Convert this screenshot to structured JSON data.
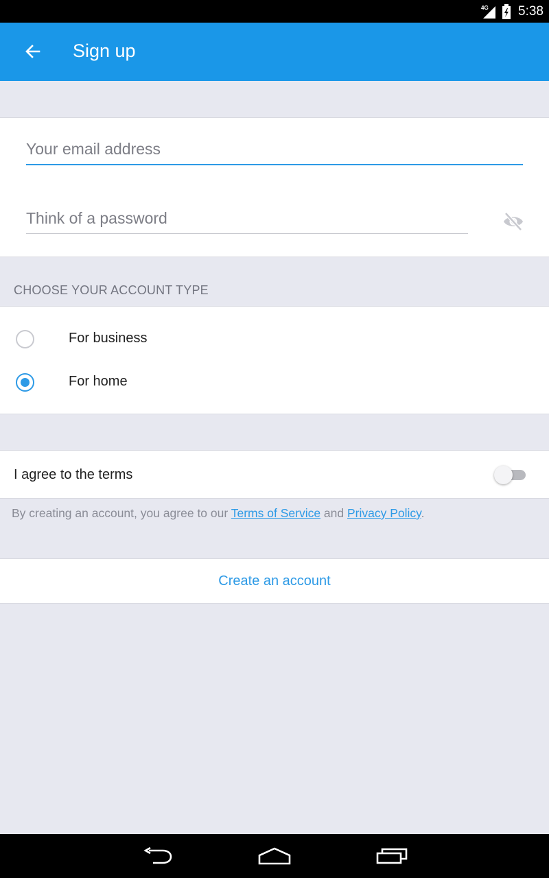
{
  "status_bar": {
    "network": "4G",
    "time": "5:38"
  },
  "app_bar": {
    "title": "Sign up",
    "color": "#1a97e8"
  },
  "form": {
    "email": {
      "placeholder": "Your email address",
      "value": ""
    },
    "password": {
      "placeholder": "Think of a password",
      "value": ""
    }
  },
  "account_type": {
    "header": "CHOOSE YOUR ACCOUNT TYPE",
    "options": [
      {
        "label": "For business",
        "selected": false
      },
      {
        "label": "For home",
        "selected": true
      }
    ]
  },
  "terms": {
    "label": "I agree to the terms",
    "toggle_on": false,
    "legal_prefix": "By creating an account, you agree to our ",
    "tos_link": "Terms of Service",
    "legal_and": " and ",
    "privacy_link": "Privacy Policy",
    "legal_suffix": "."
  },
  "actions": {
    "create_account": "Create an account"
  },
  "colors": {
    "accent": "#2d9ae6",
    "background": "#e7e8f0"
  },
  "icons": {
    "back": "arrow-left-icon",
    "password_visibility": "eye-off-icon",
    "nav": [
      "back-icon",
      "home-icon",
      "recents-icon"
    ]
  }
}
